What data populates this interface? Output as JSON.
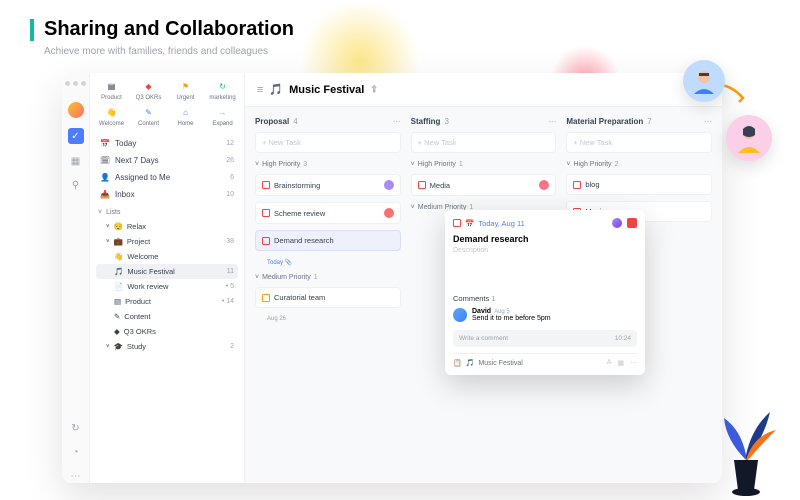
{
  "header": {
    "title": "Sharing and Collaboration",
    "subtitle": "Achieve more with families, friends and colleagues"
  },
  "quick": [
    {
      "icon": "▤",
      "label": "Product",
      "color": "#111827"
    },
    {
      "icon": "◆",
      "label": "Q3 OKRs",
      "color": "#ef4444"
    },
    {
      "icon": "⚑",
      "label": "Urgent",
      "color": "#f59e0b"
    },
    {
      "icon": "↻",
      "label": "marketing",
      "color": "#10b981"
    },
    {
      "icon": "👋",
      "label": "Welcome",
      "color": "#f59e0b"
    },
    {
      "icon": "✎",
      "label": "Content",
      "color": "#3b82f6"
    },
    {
      "icon": "⌂",
      "label": "Home",
      "color": "#3b82f6"
    },
    {
      "icon": "→",
      "label": "Expand",
      "color": "#9ca3af"
    }
  ],
  "smart": [
    {
      "icon": "📅",
      "label": "Today",
      "count": "12"
    },
    {
      "icon": "🗓",
      "label": "Next 7 Days",
      "count": "26"
    },
    {
      "icon": "👤",
      "label": "Assigned to Me",
      "count": "6"
    },
    {
      "icon": "📥",
      "label": "Inbox",
      "count": "10"
    }
  ],
  "lists_header": "Lists",
  "lists": [
    {
      "icon": "😌",
      "label": "Relax",
      "count": "",
      "child": false,
      "active": false
    },
    {
      "icon": "💼",
      "label": "Project",
      "count": "38",
      "child": false,
      "active": false
    },
    {
      "icon": "👋",
      "label": "Welcome",
      "count": "",
      "child": true,
      "active": false
    },
    {
      "icon": "🎵",
      "label": "Music Festival",
      "count": "11",
      "child": true,
      "active": true
    },
    {
      "icon": "📄",
      "label": "Work review",
      "count": "• 5",
      "child": true,
      "active": false
    },
    {
      "icon": "▤",
      "label": "Product",
      "count": "• 14",
      "child": true,
      "active": false
    },
    {
      "icon": "✎",
      "label": "Content",
      "count": "",
      "child": true,
      "active": false
    },
    {
      "icon": "◆",
      "label": "Q3 OKRs",
      "count": "",
      "child": true,
      "active": false
    },
    {
      "icon": "🎓",
      "label": "Study",
      "count": "2",
      "child": false,
      "active": false
    }
  ],
  "board": {
    "title": "Music Festival",
    "icon": "🎵"
  },
  "columns": [
    {
      "name": "Proposal",
      "count": "4",
      "groups": [
        {
          "label": "High Priority",
          "count": "3",
          "cards": [
            {
              "title": "Brainstorming",
              "check": "red",
              "avatar": "#a78bfa",
              "selected": false
            },
            {
              "title": "Scheme review",
              "check": "red",
              "avatar": "#f87171",
              "selected": false
            },
            {
              "title": "Demand research",
              "check": "red",
              "avatar": "",
              "selected": true,
              "meta": "Today",
              "metaIcon": "📎"
            }
          ]
        },
        {
          "label": "Medium Priority",
          "count": "1",
          "cards": [
            {
              "title": "Curatorial team",
              "check": "yellow",
              "avatar": "",
              "selected": false,
              "metaGray": "Aug 26"
            }
          ]
        }
      ]
    },
    {
      "name": "Staffing",
      "count": "3",
      "groups": [
        {
          "label": "High Priority",
          "count": "1",
          "cards": [
            {
              "title": "Media",
              "check": "red",
              "avatar": "#fb7185",
              "selected": false
            }
          ]
        },
        {
          "label": "Medium Priority",
          "count": "1",
          "cards": []
        }
      ]
    },
    {
      "name": "Material Preparation",
      "count": "7",
      "groups": [
        {
          "label": "High Priority",
          "count": "2",
          "cards": [
            {
              "title": "blog",
              "check": "red",
              "avatar": "",
              "selected": false
            },
            {
              "title": "Music",
              "check": "red",
              "avatar": "",
              "selected": false
            }
          ]
        }
      ]
    }
  ],
  "new_task": "+ New Task",
  "popup": {
    "date": "Today, Aug 11",
    "title": "Demand research",
    "desc": "Description",
    "comments_h": "Comments",
    "comments_c": "1",
    "comment": {
      "name": "David",
      "date": "Aug 5",
      "text": "Send it to me before 5pm"
    },
    "input_placeholder": "Write a comment",
    "input_time": "10:24",
    "footer_list": "Music Festival"
  }
}
